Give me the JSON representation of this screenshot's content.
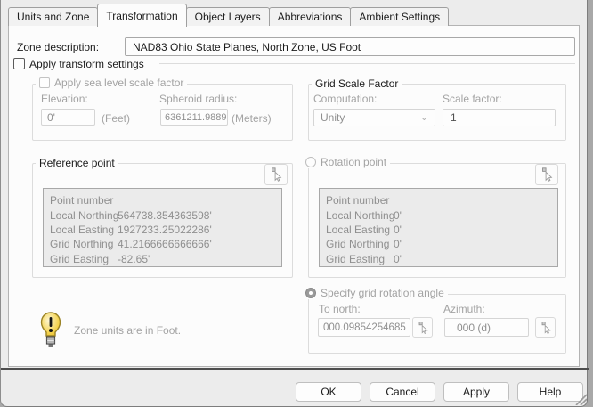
{
  "tabs": [
    {
      "label": "Units and Zone",
      "active": false
    },
    {
      "label": "Transformation",
      "active": true
    },
    {
      "label": "Object Layers",
      "active": false
    },
    {
      "label": "Abbreviations",
      "active": false
    },
    {
      "label": "Ambient Settings",
      "active": false
    }
  ],
  "zone": {
    "label": "Zone description:",
    "value": "NAD83 Ohio State Planes, North Zone, US Foot"
  },
  "apply_transform": {
    "label": "Apply transform settings",
    "checked": false
  },
  "sea_level": {
    "title": "Apply sea level scale factor",
    "checked": false,
    "elevation_label": "Elevation:",
    "elevation_value": "0'",
    "elevation_unit": "(Feet)",
    "spheroid_label": "Spheroid radius:",
    "spheroid_value": "6361211.9889",
    "spheroid_unit": "(Meters)"
  },
  "grid_scale": {
    "title": "Grid Scale Factor",
    "computation_label": "Computation:",
    "computation_value": "Unity",
    "scale_factor_label": "Scale factor:",
    "scale_factor_value": "1"
  },
  "reference_point": {
    "title": "Reference point",
    "rows": [
      {
        "label": "Point number",
        "value": ""
      },
      {
        "label": "Local Northing",
        "value": "564738.354363598'"
      },
      {
        "label": "Local Easting",
        "value": "1927233.25022286'"
      },
      {
        "label": "Grid Northing",
        "value": "41.2166666666666'"
      },
      {
        "label": "Grid Easting",
        "value": "-82.65'"
      }
    ]
  },
  "rotation_point": {
    "title": "Rotation point",
    "selected": false,
    "rows": [
      {
        "label": "Point number",
        "value": ""
      },
      {
        "label": "Local Northing",
        "value": "0'"
      },
      {
        "label": "Local Easting",
        "value": "0'"
      },
      {
        "label": "Grid Northing",
        "value": "0'"
      },
      {
        "label": "Grid Easting",
        "value": "0'"
      }
    ]
  },
  "rotation_angle": {
    "title": "Specify grid rotation angle",
    "selected": true,
    "to_north_label": "To north:",
    "to_north_value": "000.09854254685",
    "azimuth_label": "Azimuth:",
    "azimuth_value": "000 (d)"
  },
  "note": {
    "text": "Zone units are in Foot."
  },
  "buttons": [
    {
      "label": "OK"
    },
    {
      "label": "Cancel"
    },
    {
      "label": "Apply"
    },
    {
      "label": "Help"
    }
  ],
  "icons": {
    "pick": "pick-cursor-icon",
    "note": "lightbulb-alert-icon",
    "combo": "chevron-down-icon",
    "grip": "resize-grip-icon"
  },
  "colors": {
    "bulb_yellow": "#f2cf45",
    "separator_dark": "#4d4d4d",
    "disabled_text": "#a3a3a3",
    "table_bg": "#ebebeb"
  }
}
